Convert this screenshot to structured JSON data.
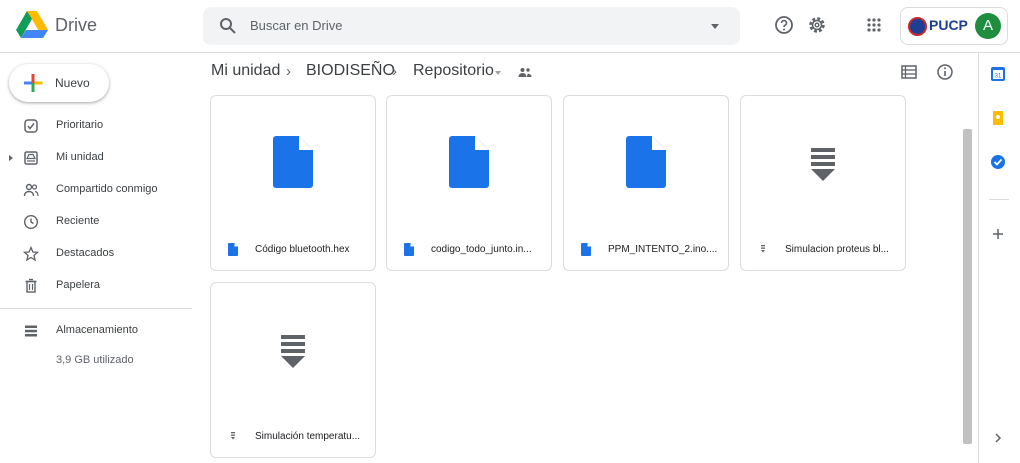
{
  "app": {
    "name": "Drive"
  },
  "search": {
    "placeholder": "Buscar en Drive"
  },
  "org": {
    "name": "PUCP"
  },
  "user": {
    "initial": "A"
  },
  "sidebar": {
    "new_label": "Nuevo",
    "items": [
      {
        "label": "Prioritario",
        "icon": "priority-icon"
      },
      {
        "label": "Mi unidad",
        "icon": "my-drive-icon"
      },
      {
        "label": "Compartido conmigo",
        "icon": "shared-icon"
      },
      {
        "label": "Reciente",
        "icon": "clock-icon"
      },
      {
        "label": "Destacados",
        "icon": "star-icon"
      },
      {
        "label": "Papelera",
        "icon": "trash-icon"
      }
    ],
    "storage": {
      "label": "Almacenamiento",
      "used": "3,9 GB utilizado"
    }
  },
  "breadcrumb": [
    "Mi unidad",
    "BIODISEÑO",
    "Repositorio"
  ],
  "files": [
    {
      "name": "Código bluetooth.hex",
      "type": "doc"
    },
    {
      "name": "codigo_todo_junto.in...",
      "type": "doc"
    },
    {
      "name": "PPM_INTENTO_2.ino....",
      "type": "doc"
    },
    {
      "name": "Simulacion proteus bl...",
      "type": "archive"
    },
    {
      "name": "Simulación temperatu...",
      "type": "archive"
    }
  ],
  "colors": {
    "accent": "#1a73e8",
    "archive": "#5f6368",
    "avatar": "#1e8e3e"
  }
}
